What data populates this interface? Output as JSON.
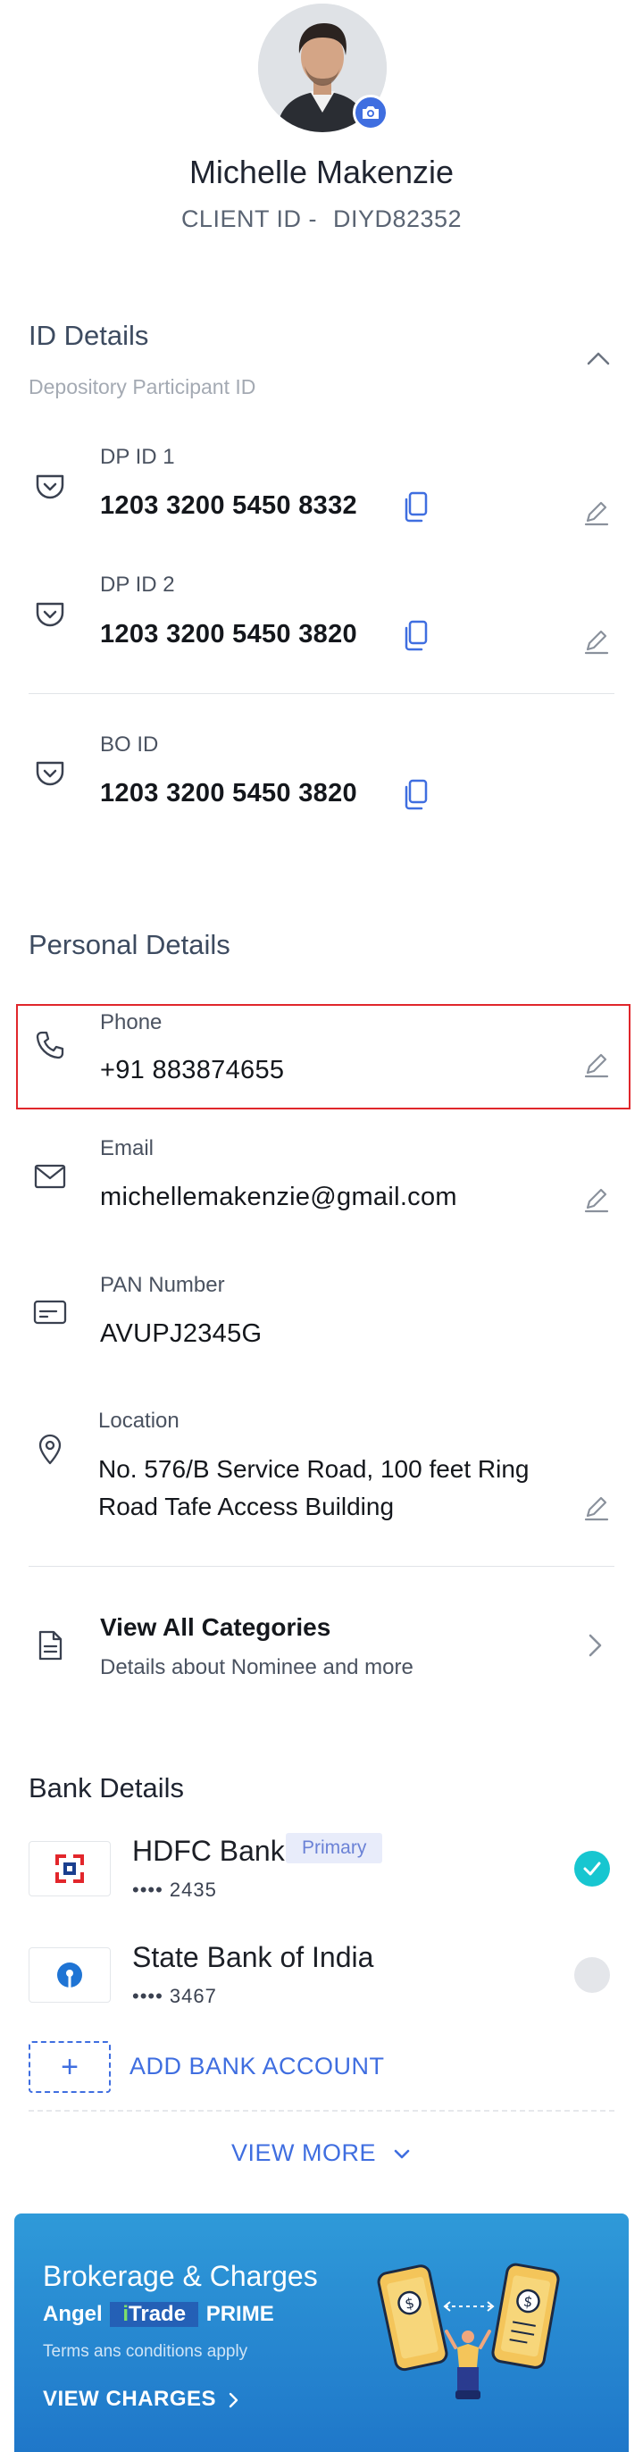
{
  "profile": {
    "name": "Michelle Makenzie",
    "client_id_label": "CLIENT ID -",
    "client_id": "DIYD82352"
  },
  "id_details": {
    "title": "ID Details",
    "subtitle": "Depository Participant ID",
    "items": [
      {
        "label": "DP ID 1",
        "value": "1203 3200 5450 8332"
      },
      {
        "label": "DP ID 2",
        "value": "1203 3200 5450 3820"
      },
      {
        "label": "BO ID",
        "value": "1203 3200 5450 3820"
      }
    ]
  },
  "personal_details": {
    "title": "Personal Details",
    "phone": {
      "label": "Phone",
      "value": "+91  883874655"
    },
    "email": {
      "label": "Email",
      "value": "michellemakenzie@gmail.com"
    },
    "pan": {
      "label": "PAN Number",
      "value": "AVUPJ2345G"
    },
    "location": {
      "label": "Location",
      "value": "No. 576/B Service Road, 100 feet Ring Road Tafe Access Building"
    }
  },
  "categories": {
    "title": "View All Categories",
    "subtitle": "Details about Nominee and more"
  },
  "bank_details": {
    "title": "Bank Details",
    "banks": [
      {
        "name": "HDFC Bank",
        "masked": "•••• 2435",
        "badge": "Primary",
        "selected": true
      },
      {
        "name": "State Bank of India",
        "masked": "•••• 3467",
        "selected": false
      }
    ],
    "add_label": "ADD BANK ACCOUNT",
    "add_icon": "+",
    "view_more": "VIEW MORE"
  },
  "banner": {
    "title": "Brokerage & Charges",
    "brand_prefix": "Angel",
    "brand_i": "i",
    "brand_trade": "Trade",
    "brand_suffix": "PRIME",
    "terms": "Terms ans conditions apply",
    "cta": "VIEW CHARGES"
  },
  "colors": {
    "accent": "#3f6ee0",
    "selected": "#17c6d0",
    "highlight": "#e0262b",
    "banner": "#2589d2"
  },
  "icons": {
    "dp": "depository-icon",
    "copy": "copy-icon",
    "edit": "pencil-icon",
    "phone": "phone-icon",
    "email": "mail-icon",
    "pan": "id-card-icon",
    "location": "location-pin-icon",
    "document": "document-icon",
    "chevron": "chevron-right-icon"
  }
}
